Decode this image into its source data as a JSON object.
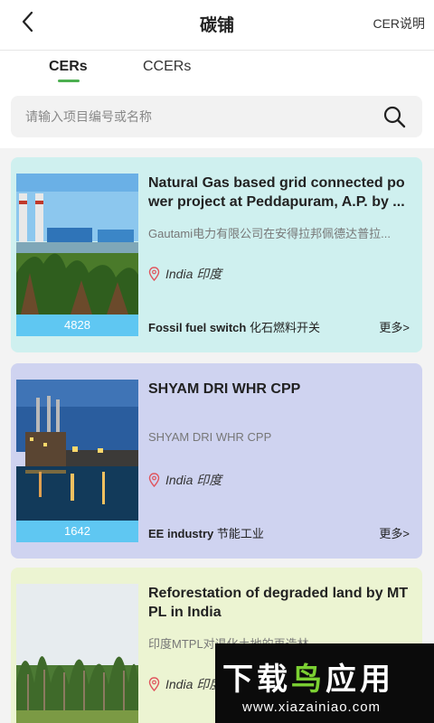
{
  "header": {
    "title": "碳铺",
    "help_label": "CER说明"
  },
  "tabs": [
    {
      "label": "CERs",
      "active": true
    },
    {
      "label": "CCERs",
      "active": false
    }
  ],
  "search": {
    "placeholder": "请输入项目编号或名称"
  },
  "accent_color": "#4caf50",
  "cards": [
    {
      "title": "Natural Gas based grid connected power project at Peddapuram, A.P. by ...",
      "subtitle": "Gautami电力有限公司在安得拉邦佩德达普拉...",
      "location": "India 印度",
      "category_en": "Fossil fuel switch",
      "category_zh": "化石燃料开关",
      "count": "4828",
      "more": "更多>",
      "bg_color": "#cff0ef"
    },
    {
      "title": "SHYAM DRI WHR CPP",
      "subtitle": "SHYAM DRI WHR CPP",
      "location": "India 印度",
      "category_en": "EE industry",
      "category_zh": "节能工业",
      "count": "1642",
      "more": "更多>",
      "bg_color": "#cfd3f0"
    },
    {
      "title": "Reforestation of degraded land by MTPL in India",
      "subtitle": "印度MTPL对退化土地的再造林",
      "location": "India 印度",
      "bg_color": "#ecf4d2"
    }
  ],
  "watermark": {
    "brand": "下载鸟应用",
    "url": "www.xiazainiao.com"
  }
}
